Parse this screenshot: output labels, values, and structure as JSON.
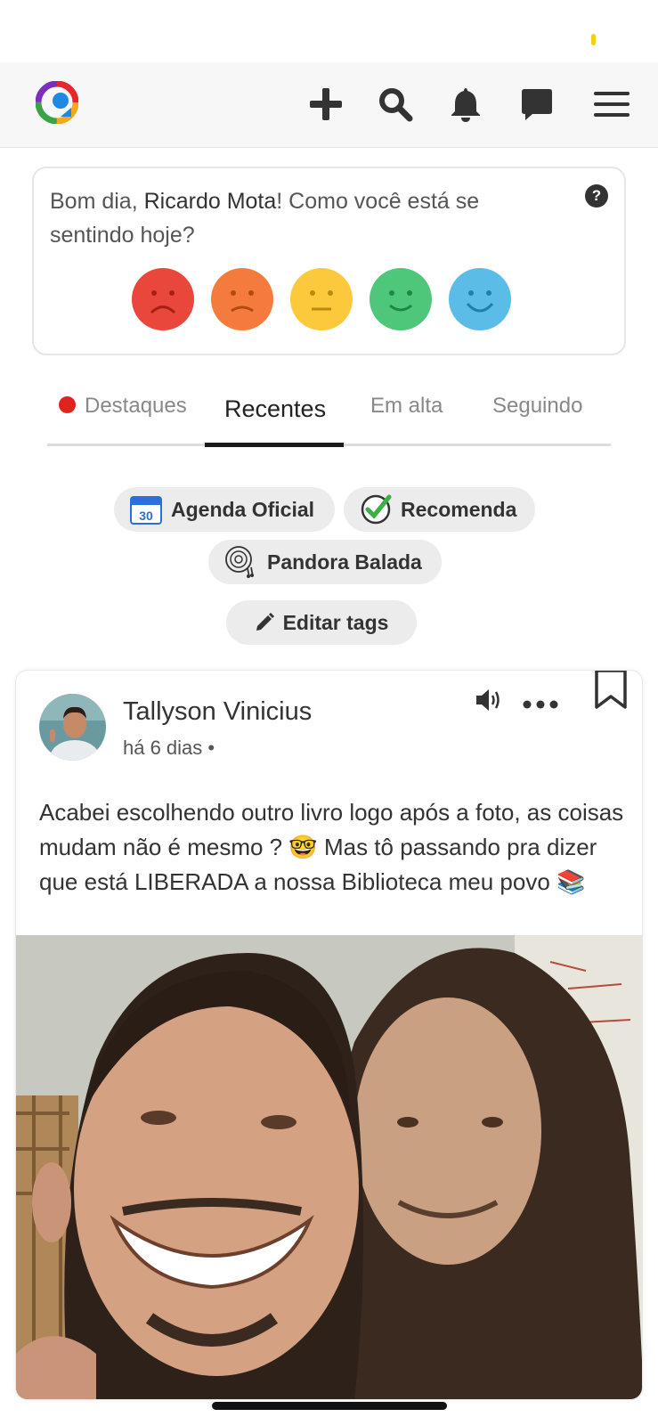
{
  "header": {
    "icons": {
      "logo": "app-logo-icon",
      "add": "plus-icon",
      "search": "search-icon",
      "notifications": "bell-icon",
      "messages": "chat-icon",
      "menu": "hamburger-menu-icon"
    }
  },
  "mood": {
    "greeting": "Bom dia, ",
    "user_name": "Ricardo Mota",
    "question": "! Como você está se sentindo hoje?",
    "help_label": "?",
    "faces": [
      {
        "icon": "very-sad-face-icon",
        "color": "#e9473b"
      },
      {
        "icon": "sad-face-icon",
        "color": "#f47b3d"
      },
      {
        "icon": "neutral-face-icon",
        "color": "#fbc93b"
      },
      {
        "icon": "happy-face-icon",
        "color": "#4fc77b"
      },
      {
        "icon": "very-happy-face-icon",
        "color": "#5bbce8"
      }
    ]
  },
  "tabs": [
    {
      "label": "Destaques",
      "active": false
    },
    {
      "label": "Recentes",
      "active": true
    },
    {
      "label": "Em alta",
      "active": false
    },
    {
      "label": "Seguindo",
      "active": false
    }
  ],
  "tags": [
    {
      "label": "Agenda Oficial",
      "icon": "calendar-icon",
      "icon_text": "30"
    },
    {
      "label": "Recomenda",
      "icon": "check-circle-icon"
    },
    {
      "label": "Pandora Balada",
      "icon": "vinyl-record-icon"
    }
  ],
  "edit_tags": {
    "label": "Editar tags",
    "icon": "pencil-icon"
  },
  "post": {
    "author": "Tallyson Vinicius",
    "time": "há 6 dias •",
    "text": "Acabei escolhendo outro livro logo após a foto, as coisas mudam não é mesmo ? 🤓 Mas tô passando pra dizer que está LIBERADA  a nossa Biblioteca meu povo 📚",
    "icons": {
      "audio": "speaker-icon",
      "more": "more-dots-icon",
      "bookmark": "bookmark-icon"
    }
  },
  "colors": {
    "tab_dot": "#e0231c",
    "chip_bg": "#ececec",
    "status_dot": "#f4d20b"
  }
}
